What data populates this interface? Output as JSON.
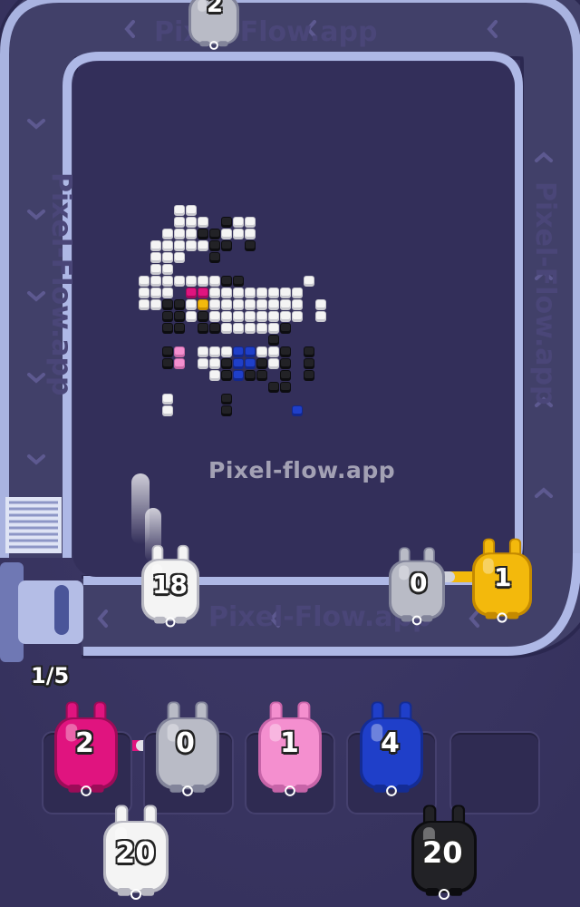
{
  "watermark": "Pixel-flow.app",
  "belt_text": [
    "Pixel-Flow.app",
    "Pixel-Flow.app",
    "Pixel-Flow.app",
    "Pixel-Flow.app"
  ],
  "progress_label": "1/5",
  "colors": {
    "background": "#3b3763",
    "board": "#322f59",
    "belt": "#9fa9d6",
    "white": "#f4f4f4",
    "black": "#222226",
    "magenta": "#e0147f",
    "pink": "#f48fcf",
    "blue": "#1f3fc9",
    "yellow": "#f3b90c",
    "gray": "#b9bbc6"
  },
  "top_shooter": {
    "count": "2",
    "color": "gray"
  },
  "conveyor_shooters": [
    {
      "count": "18",
      "color": "white"
    },
    {
      "count": "0",
      "color": "gray"
    },
    {
      "count": "1",
      "color": "yellow"
    }
  ],
  "slot_shooters": [
    {
      "count": "2",
      "color": "magenta"
    },
    {
      "count": "0",
      "color": "gray"
    },
    {
      "count": "1",
      "color": "pink"
    },
    {
      "count": "4",
      "color": "blue"
    }
  ],
  "queue_shooters": [
    {
      "count": "20",
      "color": "white"
    },
    {
      "count": "20",
      "color": "black"
    }
  ],
  "pixel_art": {
    "columns": 17,
    "rows": 18,
    "legend": {
      "W": "white",
      "K": "black",
      "M": "magenta",
      "P": "pink",
      "B": "blue",
      "Y": "yellow"
    },
    "grid": [
      "...WW............",
      "...WWW.KWW.......",
      "..WWWKKWWW.......",
      ".WWWWWKK.K.......",
      ".WWW..K..........",
      ".WW..............",
      "WWWWWWWKK.....W..",
      "WWW.MMWWWWWWWW...",
      "WWKKWYWWWWWWWW.W.",
      "..KKWKWWWWWWWW.W.",
      "..KK.KKWWWWWK....",
      "...........K.....",
      "..KP.WWWBBWWK.K..",
      "..KP.WWKBBKWK.K..",
      "......WKBKK.K.K..",
      "...........KK....",
      "..W....K.........",
      "..W....K.....B..."
    ]
  }
}
